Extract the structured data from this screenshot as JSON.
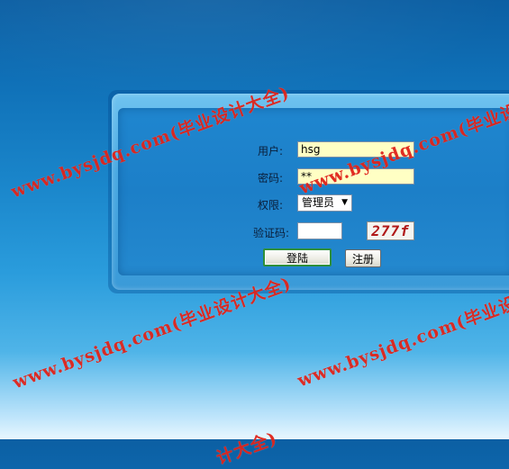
{
  "login_form": {
    "username_label": "用户:",
    "username_value": "hsg",
    "password_label": "密码:",
    "password_value": "**",
    "role_label": "权限:",
    "role_selected": "管理员",
    "captcha_label": "验证码:",
    "captcha_value": "",
    "captcha_image_text": "277f",
    "login_button": "登陆",
    "register_button": "注册"
  },
  "watermark": {
    "text": "www.bysjdq.com(毕业设计大全)",
    "fragment": "计大全)"
  },
  "colors": {
    "background_top": "#0c5fa3",
    "background_bottom": "#e8f7ff",
    "panel": "#4aa9e2",
    "input_fill": "#ffffc4",
    "watermark": "#de1c12",
    "captcha_text": "#b01818",
    "login_border": "#2f8f3a"
  },
  "icons": {
    "select_caret": "▼"
  }
}
